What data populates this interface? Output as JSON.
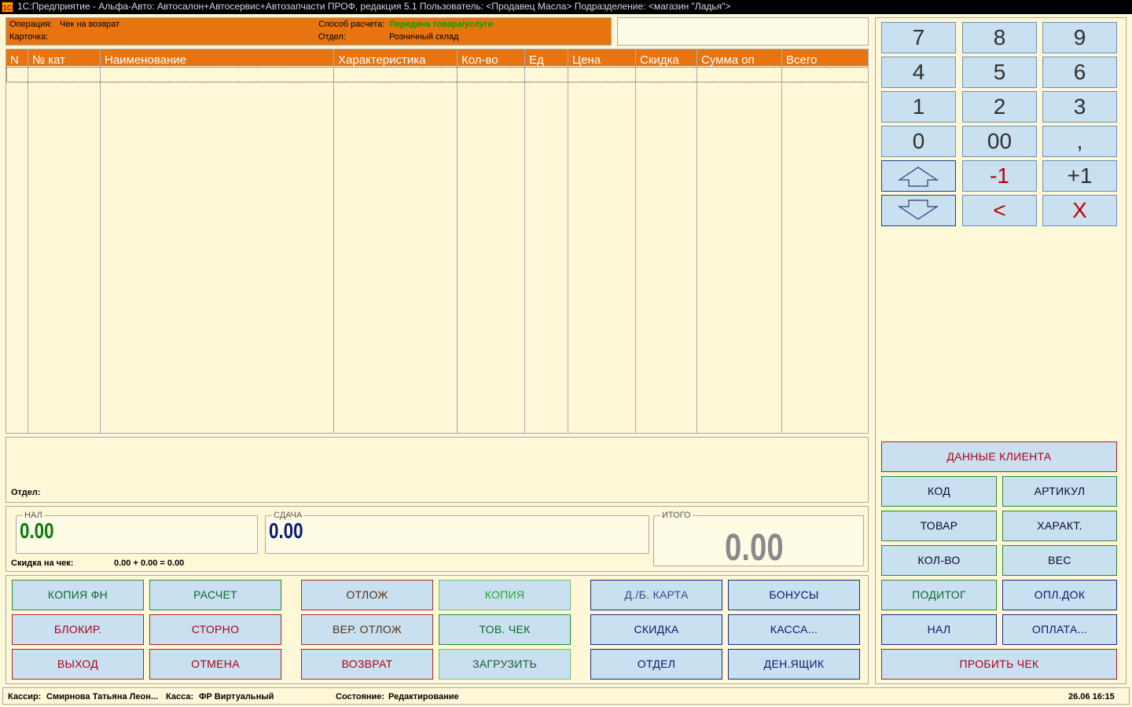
{
  "window": {
    "title": "1С:Предприятие - Альфа-Авто: Автосалон+Автосервис+Автозапчасти ПРОФ, редакция 5.1    Пользователь: <Продавец Масла>    Подразделение: <магазин \"Ладья\">",
    "logo_text": "1С"
  },
  "info": {
    "operation_label": "Операция:",
    "operation_value": "Чек на возврат",
    "card_label": "Карточка:",
    "payment_label": "Способ расчета:",
    "payment_value": "Передача товара/услуги",
    "department_label": "Отдел:",
    "department_value": "Розничный склад"
  },
  "table": {
    "columns": [
      "N",
      "№ кат",
      "Наименование",
      "Характеристика",
      "Кол-во",
      "Ед",
      "Цена",
      "Скидка",
      "Сумма оп",
      "Всего"
    ],
    "rows": []
  },
  "notes": {
    "department_label": "Отдел:"
  },
  "sums": {
    "cash_label": "НАЛ",
    "cash_value": "0.00",
    "change_label": "СДАЧА",
    "change_value": "0.00",
    "total_label": "ИТОГО",
    "total_value": "0.00",
    "discount_label": "Скидка на чек:",
    "discount_value": "0.00 + 0.00 = 0.00"
  },
  "buttons": {
    "copy_fn": "КОПИЯ ФН",
    "calc": "РАСЧЕТ",
    "defer": "ОТЛОЖ",
    "copy": "КОПИЯ",
    "card": "Д./Б. КАРТА",
    "bonuses": "БОНУСЫ",
    "block": "БЛОКИР.",
    "storno": "СТОРНО",
    "return_deferred": "ВЕР. ОТЛОЖ",
    "goods_receipt": "ТОВ. ЧЕК",
    "discount": "СКИДКА",
    "register": "КАССА...",
    "exit": "ВЫХОД",
    "cancel": "ОТМЕНА",
    "return": "ВОЗВРАТ",
    "load": "ЗАГРУЗИТЬ",
    "department": "ОТДЕЛ",
    "cash_drawer": "ДЕН.ЯЩИК"
  },
  "keypad": {
    "k7": "7",
    "k8": "8",
    "k9": "9",
    "k4": "4",
    "k5": "5",
    "k6": "6",
    "k1": "1",
    "k2": "2",
    "k3": "3",
    "k0": "0",
    "k00": "00",
    "comma": ",",
    "minus_one": "-1",
    "plus_one": "+1",
    "backspace": "<",
    "clear": "X"
  },
  "right_buttons": {
    "client_data": "ДАННЫЕ КЛИЕНТА",
    "code": "КОД",
    "article": "АРТИКУЛ",
    "goods": "ТОВАР",
    "characteristic": "ХАРАКТ.",
    "quantity": "КОЛ-ВО",
    "weight": "ВЕС",
    "subtotal": "ПОДИТОГ",
    "pay_doc": "ОПЛ.ДОК",
    "cash": "НАЛ",
    "payment": "ОПЛАТА...",
    "print_receipt": "ПРОБИТЬ ЧЕК"
  },
  "statusbar": {
    "cashier_label": "Кассир:",
    "cashier_value": "Смирнова Татьяна Леон...",
    "register_label": "Касса:",
    "register_value": "ФР Виртуальный",
    "state_label": "Состояние:",
    "state_value": "Редактирование",
    "datetime": "26.06 16:15"
  }
}
